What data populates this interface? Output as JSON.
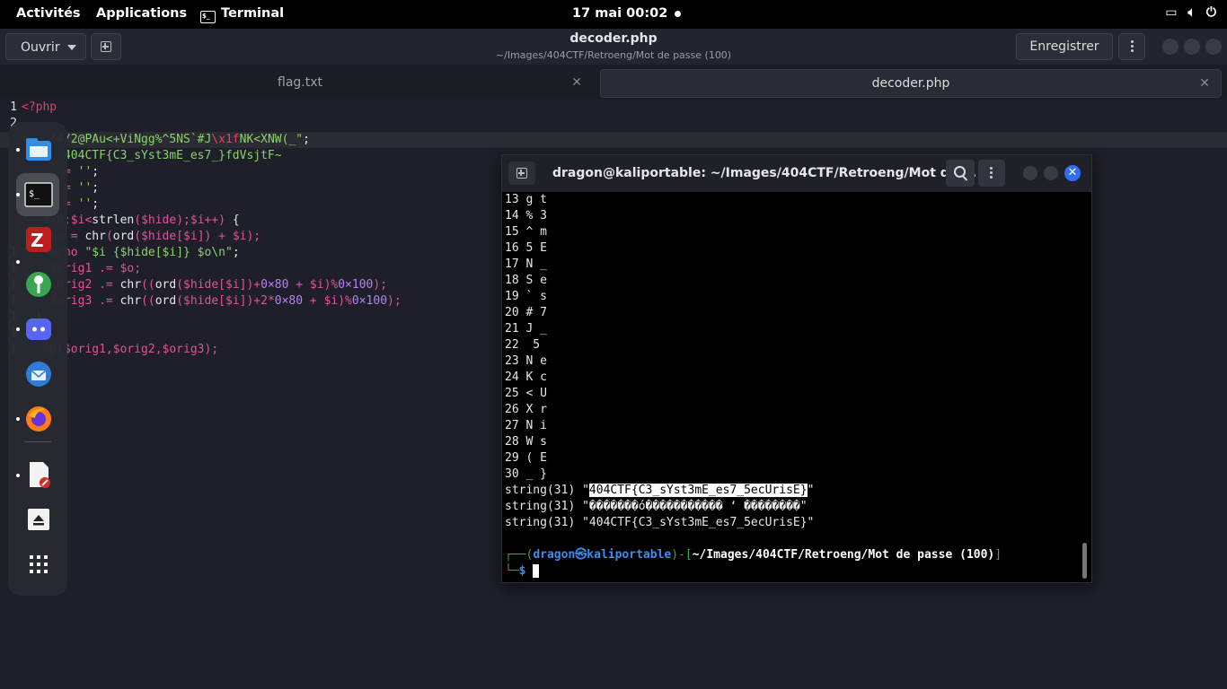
{
  "topbar": {
    "activities": "Activités",
    "applications": "Applications",
    "app_name": "Terminal",
    "clock": "17 mai  00:02"
  },
  "gedit": {
    "open_label": "Ouvrir",
    "title": "decoder.php",
    "subtitle": "~/Images/404CTF/Retroeng/Mot de passe (100)",
    "save_label": "Enregistrer",
    "tabs": [
      {
        "label": "flag.txt",
        "active": false
      },
      {
        "label": "decoder.php",
        "active": true
      }
    ]
  },
  "editor": {
    "line_numbers": [
      "1",
      "2",
      "",
      "",
      "",
      "",
      "",
      "",
      "",
      "1",
      "1",
      "1",
      "1",
      "1",
      "1",
      "1"
    ],
    "lines": [
      {
        "seg": [
          [
            "k-red",
            "<?php"
          ]
        ]
      },
      {
        "seg": []
      },
      {
        "seg": [
          [
            "k-pink",
            "  = "
          ],
          [
            "k-green",
            "\"4/2@PAu<+ViNgg%^5NS`#J"
          ],
          [
            "k-red",
            "\\x1f"
          ],
          [
            "k-green",
            "NK<XNW(_\""
          ],
          [
            "k-white",
            ";"
          ]
        ]
      },
      {
        "seg": [
          [
            "k-green",
            "      404CTF{C3_sYst3mE_es7_}fdVsjtF~"
          ]
        ]
      },
      {
        "seg": [
          [
            "k-pink",
            "      = "
          ],
          [
            "k-green",
            "''"
          ],
          [
            "k-white",
            ";"
          ]
        ]
      },
      {
        "seg": [
          [
            "k-pink",
            "      = "
          ],
          [
            "k-green",
            "''"
          ],
          [
            "k-white",
            ";"
          ]
        ]
      },
      {
        "seg": [
          [
            "k-pink",
            "      = "
          ],
          [
            "k-green",
            "''"
          ],
          [
            "k-white",
            ";"
          ]
        ]
      },
      {
        "seg": [
          [
            "k-pink",
            "   i=0;$i<"
          ],
          [
            "k-white",
            "strlen"
          ],
          [
            "k-pink",
            "($hide);$i++) "
          ],
          [
            "k-white",
            "{"
          ]
        ]
      },
      {
        "seg": [
          [
            "k-pink",
            "    $o = "
          ],
          [
            "k-white",
            "chr"
          ],
          [
            "k-pink",
            "("
          ],
          [
            "k-white",
            "ord"
          ],
          [
            "k-pink",
            "($hide[$i]) + $i);"
          ]
        ]
      },
      {
        "seg": [
          [
            "k-pink",
            "    echo "
          ],
          [
            "k-green",
            "\"$i {$hide[$i]} $o\\n\""
          ],
          [
            "k-white",
            ";"
          ]
        ]
      },
      {
        "seg": [
          [
            "k-pink",
            "    $orig1 .= $o;"
          ]
        ]
      },
      {
        "seg": [
          [
            "k-pink",
            "    $orig2 .= "
          ],
          [
            "k-white",
            "chr"
          ],
          [
            "k-pink",
            "(("
          ],
          [
            "k-white",
            "ord"
          ],
          [
            "k-pink",
            "($hide[$i])+"
          ],
          [
            "k-purp",
            "0×80"
          ],
          [
            "k-pink",
            " + $i)%"
          ],
          [
            "k-purp",
            "0×100"
          ],
          [
            "k-pink",
            ");"
          ]
        ]
      },
      {
        "seg": [
          [
            "k-pink",
            "    $orig3 .= "
          ],
          [
            "k-white",
            "chr"
          ],
          [
            "k-pink",
            "(("
          ],
          [
            "k-white",
            "ord"
          ],
          [
            "k-pink",
            "($hide[$i])+2*"
          ],
          [
            "k-purp",
            "0×80"
          ],
          [
            "k-pink",
            " + $i)%"
          ],
          [
            "k-purp",
            "0×100"
          ],
          [
            "k-pink",
            ");"
          ]
        ]
      },
      {
        "seg": [
          [
            "k-white",
            "  }"
          ]
        ]
      },
      {
        "seg": []
      },
      {
        "seg": [
          [
            "k-pink",
            "   mp($orig1,$orig2,$orig3);"
          ]
        ]
      }
    ]
  },
  "dock": {
    "items": [
      "files-icon",
      "terminal-icon",
      "filezilla-icon",
      "keepass-icon",
      "discord-icon",
      "thunderbird-icon",
      "firefox-icon",
      "text-editor-icon",
      "media-eject-icon",
      "show-apps-icon"
    ]
  },
  "terminal": {
    "title": "dragon@kaliportable: ~/Images/404CTF/Retroeng/Mot de ...",
    "rows": [
      "13 g t",
      "14 % 3",
      "15 ^ m",
      "16 5 E",
      "17 N _",
      "18 S e",
      "19 ` s",
      "20 # 7",
      "21 J _",
      "22  5",
      "23 N e",
      "24 K c",
      "25 < U",
      "26 X r",
      "27 N i",
      "28 W s",
      "29 ( E",
      "30 _ }"
    ],
    "dump_prefix": "string(31) \"",
    "dump1": "404CTF{C3_sYst3mE_es7_5ecUrisE}",
    "dump2": "string(31) \"�������ó����������� ‘ ��������\"",
    "dump3": "string(31) \"404CTF{C3_sYst3mE_es7_5ecUrisE}\"",
    "prompt_user": "dragon",
    "prompt_symbol": "㉿",
    "prompt_host": "kaliportable",
    "prompt_path": "~/Images/404CTF/Retroeng/Mot de passe (100)",
    "prompt_dollar": "$"
  },
  "colors": {
    "accent": "#2f6df2",
    "prompt_green": "#3aa84c",
    "prompt_blue": "#3e8cf0"
  }
}
